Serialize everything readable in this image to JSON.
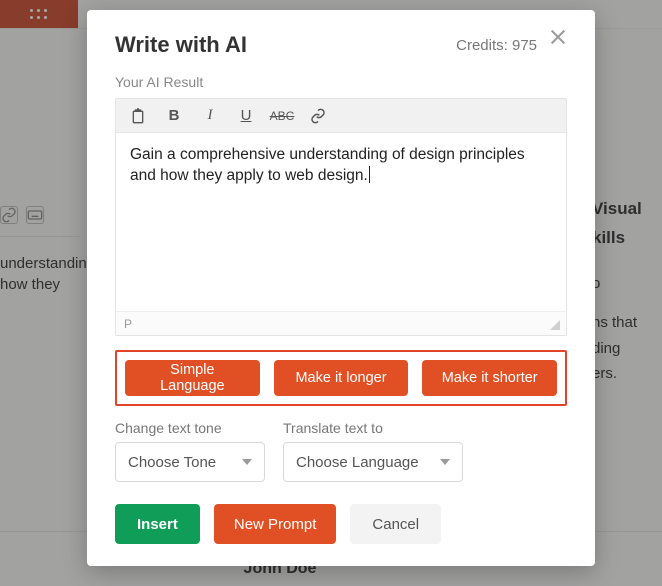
{
  "background": {
    "left_text": "understanding how they",
    "right_heading": "Visual kills",
    "right_lines": [
      "o",
      "ns that",
      "ding",
      "ers."
    ],
    "author": "John Doe"
  },
  "modal": {
    "title": "Write with AI",
    "credits_label": "Credits: 975",
    "subtitle": "Your AI Result",
    "content": "Gain a comprehensive understanding of design principles and how they apply to web design.",
    "path_label": "P",
    "adjust": {
      "simple": "Simple Language",
      "longer": "Make it longer",
      "shorter": "Make it shorter"
    },
    "tone": {
      "label": "Change text tone",
      "placeholder": "Choose Tone"
    },
    "translate": {
      "label": "Translate text to",
      "placeholder": "Choose Language"
    },
    "actions": {
      "insert": "Insert",
      "new_prompt": "New Prompt",
      "cancel": "Cancel"
    }
  }
}
